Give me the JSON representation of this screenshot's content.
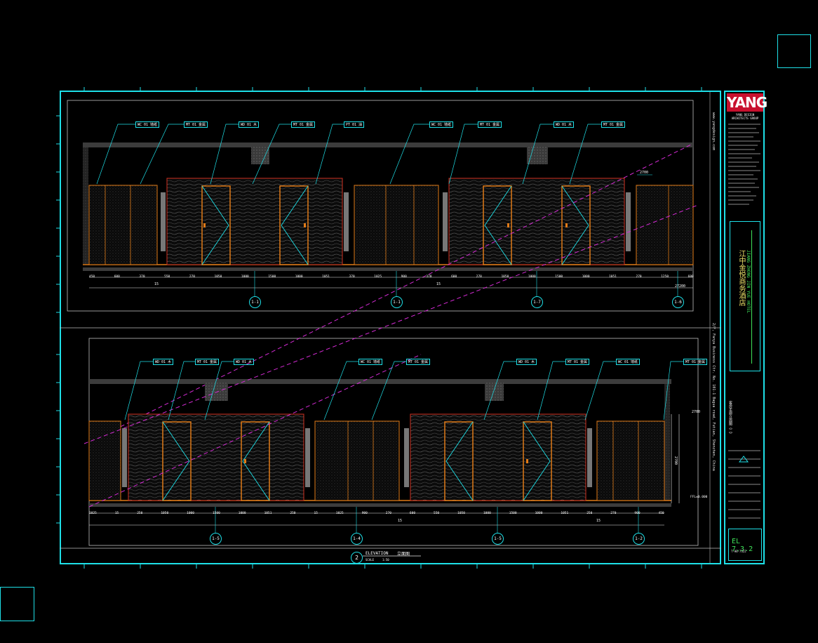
{
  "title_block": {
    "logo": "YANG",
    "company": "YANG DESIGN ARCHITECTS GROUP",
    "project_cn": "江中金悦商务酒店",
    "project_en": "JIANG ZHONG JIN YUE HOTEL",
    "drawing_number": "EL 7.3.2",
    "drawing_sub": "T-HB-7322",
    "sheet_title": "客房走廊立面图（二）",
    "side_address": "2/F, Fanya Business Ctr. No. 101-1 Bagua road, Futian, Shenzhen, China",
    "side_web": "www.yangdesign.com"
  },
  "elevation_title": {
    "circle": "2",
    "label": "ELEVATION",
    "label_cn": "立面图",
    "scale_label": "SCALE",
    "scale": "1:50"
  },
  "top_view": {
    "callouts": [
      "WC 01  墙纸",
      "MT 01  金属",
      "WD 01  木",
      "MT 01  金属",
      "PT 01  油",
      "WC 01  墙纸",
      "MT 01  金属",
      "WD 01  木",
      "MT 01  金属"
    ],
    "dims": [
      "450",
      "600",
      "370",
      "550",
      "270",
      "1050",
      "1000",
      "1500",
      "1000",
      "1051",
      "370",
      "1025",
      "900",
      "370",
      "600",
      "270",
      "1050",
      "1000",
      "1500",
      "1000",
      "1051",
      "270",
      "1250",
      "600"
    ],
    "total_left": "15",
    "total_right": "15",
    "total_far": "27200",
    "grids": [
      "1-1",
      "1-1",
      "1-7",
      "1-6"
    ],
    "level_top": "2700"
  },
  "bottom_view": {
    "callouts": [
      "WD 01  木",
      "MT 01  金属",
      "WD 01  木",
      "WC 01  墙纸",
      "MT 01  金属",
      "WD 01  木",
      "MT 01  金属",
      "WC 01  墙纸",
      "MT 01  金属"
    ],
    "dims": [
      "1025",
      "15",
      "250",
      "1050",
      "1000",
      "1500",
      "1000",
      "1051",
      "250",
      "15",
      "1025",
      "900",
      "270",
      "600",
      "550",
      "1050",
      "1000",
      "1500",
      "1000",
      "1051",
      "250",
      "270",
      "900",
      "450"
    ],
    "total_left": "15",
    "total_right": "15",
    "grids": [
      "1-5",
      "1-4",
      "1-5",
      "1-2"
    ],
    "level_top": "2700",
    "level_bottom": "FFL±0.000",
    "height": "2700"
  }
}
